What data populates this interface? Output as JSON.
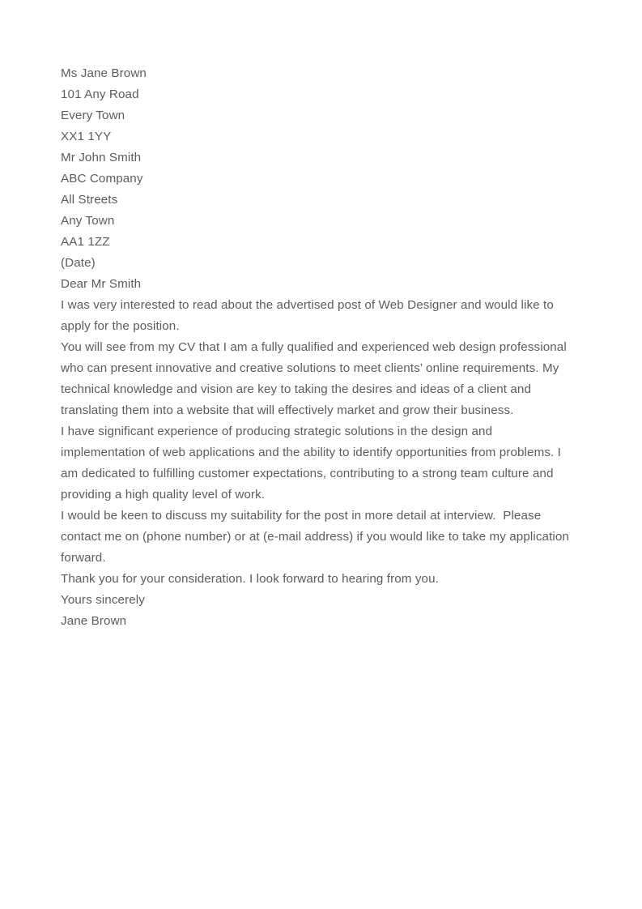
{
  "document": {
    "type": "cover-letter",
    "text_color": "#5c5c5c",
    "background_color": "#ffffff",
    "sender_address": [
      "Ms Jane Brown",
      "101 Any Road",
      "Every Town",
      "XX1 1YY"
    ],
    "recipient_address": [
      "Mr John Smith",
      "ABC Company",
      "All Streets",
      "Any Town",
      "AA1 1ZZ"
    ],
    "date_line": "(Date)",
    "salutation": "Dear Mr Smith",
    "paragraphs": [
      "I was very interested to read about the advertised post of Web Designer and would like to apply for the position.",
      "You will see from my CV that I am a fully qualified and experienced web design professional who can present innovative and creative solutions to meet clients’ online requirements. My technical knowledge and vision are key to taking the desires and ideas of a client and translating them into a website that will effectively market and grow their business.",
      "I have significant experience of producing strategic solutions in the design and implementation of web applications and the ability to identify opportunities from problems. I am dedicated to fulfilling customer expectations, contributing to a strong team culture and providing a high quality level of work.",
      "I would be keen to discuss my suitability for the post in more detail at interview.  Please contact me on (phone number) or at (e-mail address) if you would like to take my application forward.",
      "Thank you for your consideration. I look forward to hearing from you."
    ],
    "closing": "Yours sincerely",
    "signature_name": "Jane Brown"
  }
}
